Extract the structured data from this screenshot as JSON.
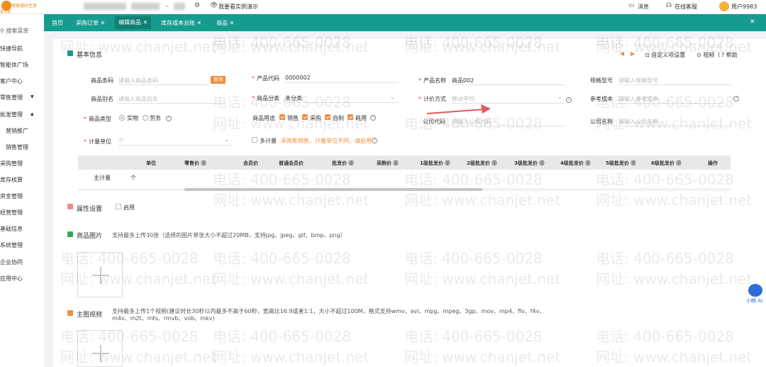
{
  "topbar": {
    "logo_text": "畅捷通好生意",
    "logo_sub": "基本版",
    "demo_text": "我要看实例演示",
    "messages": "消息",
    "support": "在线客服",
    "user": "用户9983"
  },
  "sidebar": {
    "search": "搜索菜单",
    "items": [
      "快捷导航",
      "智能体广场",
      "客户中心",
      "零售管理",
      "批发管理",
      "营销推广",
      "销售管理",
      "采购管理",
      "库存核算",
      "资金管理",
      "经营管理",
      "基础信息",
      "系统管理",
      "企业协同",
      "应用中心"
    ],
    "caret_down": "▼",
    "caret_up": "▲"
  },
  "tabs": [
    {
      "label": "首页"
    },
    {
      "label": "采购订单",
      "close": "✕"
    },
    {
      "label": "编辑商品",
      "close": "✕"
    },
    {
      "label": "库存成本总账",
      "close": "✕"
    },
    {
      "label": "商品",
      "close": "✕"
    }
  ],
  "tab_close_all": "✕",
  "basic": {
    "title": "基本信息",
    "custom_settings": "自定义项设置",
    "video": "视频",
    "help": "帮助",
    "fields": {
      "barcode_label": "商品条码",
      "barcode_ph": "请输入商品条码",
      "query": "查询",
      "code_label": "产品代码",
      "code_value": "0000002",
      "name_label": "产品名称",
      "name_value": "商品002",
      "spec_label": "规格型号",
      "spec_ph": "请输入规格型号",
      "alias_label": "商品别名",
      "alias_ph": "请输入商品别名",
      "cat_label": "商品分类",
      "cat_value": "未分类",
      "pricing_label": "计价方式",
      "pricing_value": "移动平均",
      "refcost_label": "参考成本",
      "refcost_ph": "请输入参考成本",
      "type_label": "商品类型",
      "type_opt1": "实物",
      "type_opt2": "劳务",
      "usage_label": "商品用途",
      "usage_opt1": "销售",
      "usage_opt2": "采购",
      "usage_opt3": "自制",
      "usage_opt4": "耗用",
      "compcode_label": "公司代码",
      "compcode_ph": "请输入公司代码",
      "compname_label": "公司名称",
      "compname_ph": "请输入公司名称",
      "unit_label": "计量单位",
      "unit_ph": "个",
      "multi_label": "多计量",
      "multi_note": "采购和销售、计量单位不同，请启用"
    }
  },
  "unit_table": {
    "headers": [
      "单位",
      "零售价",
      "会员价",
      "普通会员价",
      "批发价",
      "采购价",
      "1级批发价",
      "2级批发价",
      "3级批发价",
      "4级批发价",
      "5级批发价",
      "6级批发价",
      "操作"
    ],
    "row": {
      "name": "主计量",
      "unit": "个"
    }
  },
  "attr": {
    "title": "属性设置",
    "enable": "启用"
  },
  "images": {
    "title": "商品图片",
    "hint": "支持最多上传30张（选择的图片单张大小不超过20MB，支持jpg、jpeg、gif、bmp、png）"
  },
  "video_sec": {
    "title": "主图视频",
    "hint1": "支持最多上传1个视频(建议时长30秒以内最多不高于60秒，宽高比16:9或者1:1，大小不超过100M，格式支持wmv、avi、mpg、mpeg、3gp、mov、mp4、flv、f4v、",
    "hint2": "m4v、m2t、mts、rmvb、vob、mkv)"
  },
  "watermark": {
    "phone": "电话: 400-665-0028",
    "site": "网址: www.chanjet.net"
  },
  "ai": {
    "label": "小畅 AI"
  },
  "colors": {
    "teal": "#149c8f",
    "orange": "#f08c3c",
    "required": "#e03e2d",
    "arrow": "#e05a5a"
  }
}
